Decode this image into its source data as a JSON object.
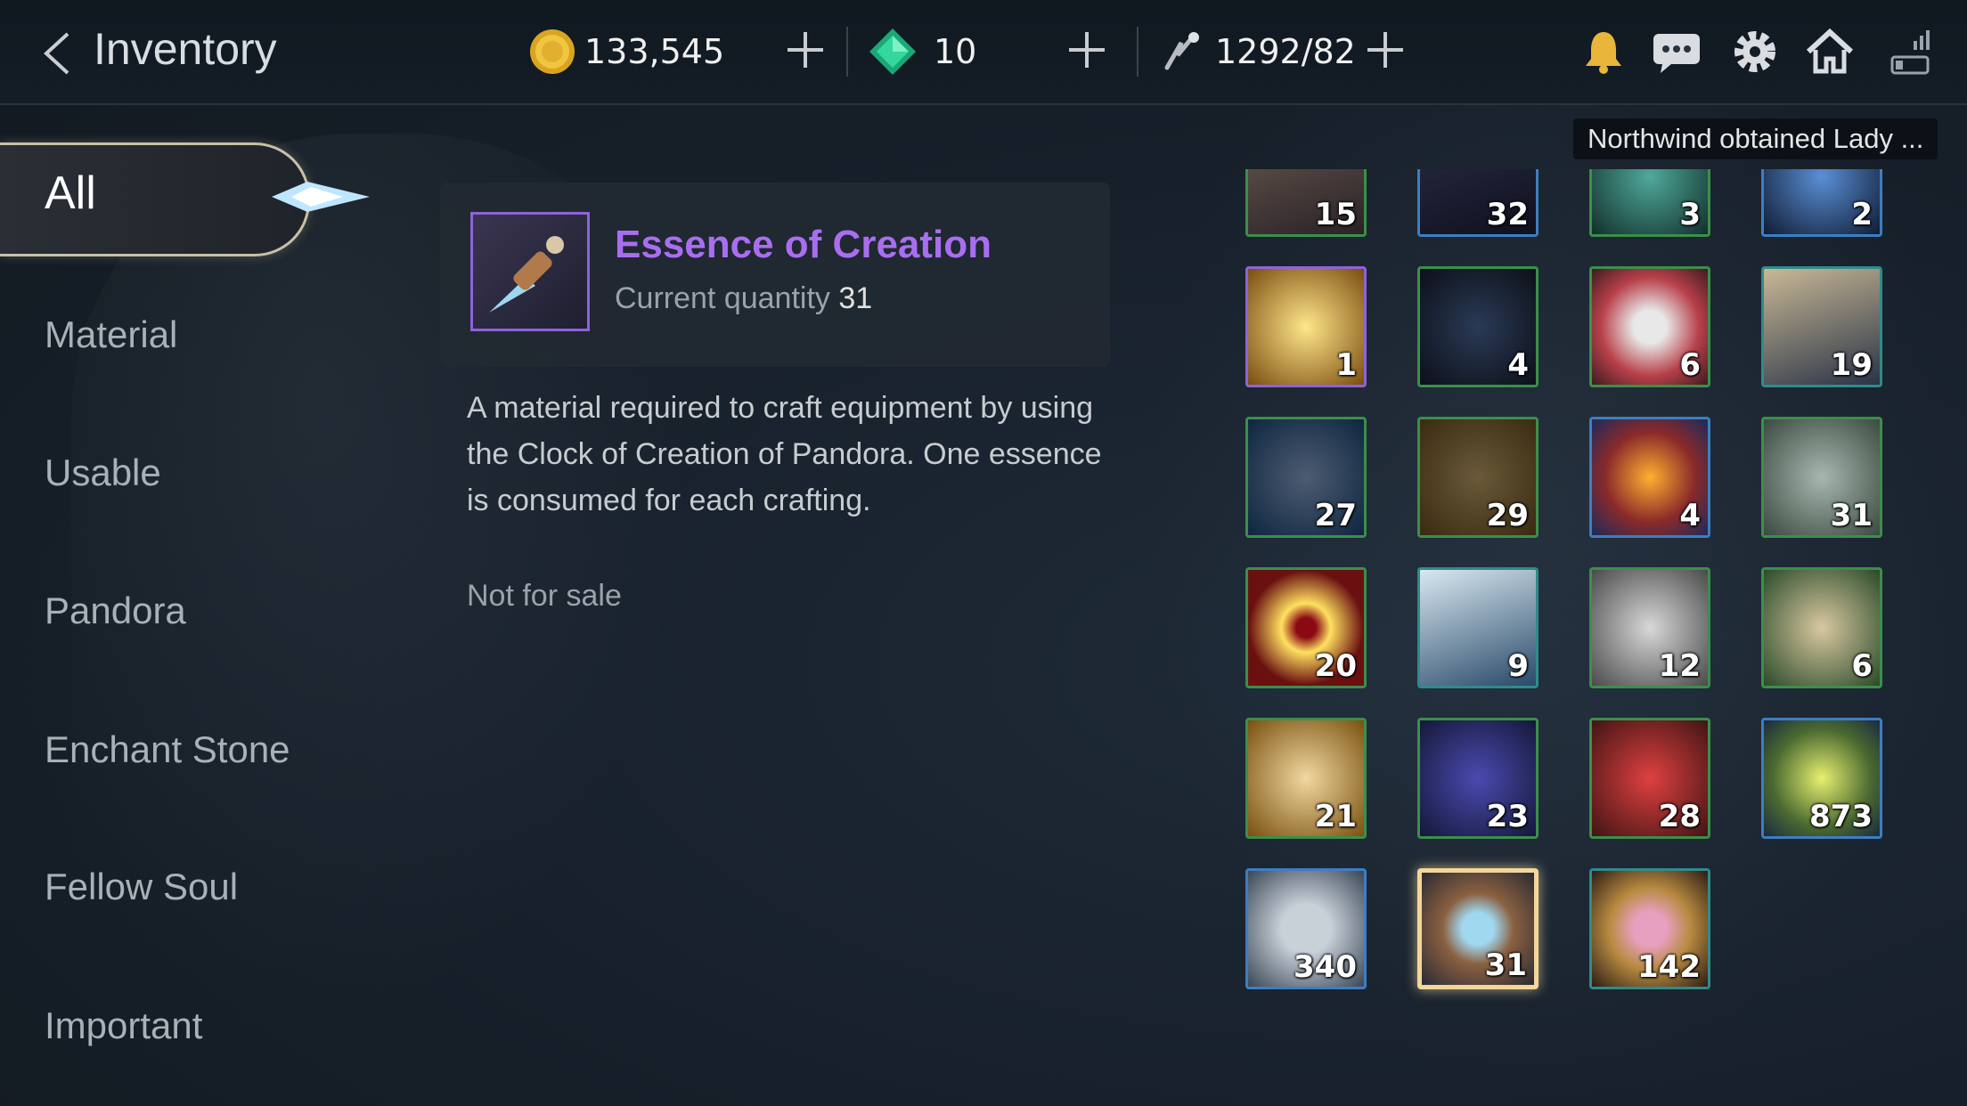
{
  "header": {
    "title": "Inventory",
    "gold": "133,545",
    "gems": "10",
    "stamina": "1292/82"
  },
  "notification": "Northwind obtained Lady ...",
  "sidebar": {
    "items": [
      {
        "label": "All",
        "active": true
      },
      {
        "label": "Material"
      },
      {
        "label": "Usable"
      },
      {
        "label": "Pandora"
      },
      {
        "label": "Enchant Stone"
      },
      {
        "label": "Fellow Soul"
      },
      {
        "label": "Important"
      }
    ]
  },
  "detail": {
    "name": "Essence of Creation",
    "qty_label": "Current quantity",
    "qty": "31",
    "description": "A material required to craft equipment by using the Clock of Creation of Pandora. One essence is consumed for each crafting.",
    "sale": "Not for sale"
  },
  "colors": {
    "accent_purple": "#a96ef0",
    "selected_border": "#f2d69a",
    "green_border": "#3b8f4a",
    "blue_border": "#3d7ec0"
  },
  "grid": [
    {
      "icon": "hero-portrait-icon",
      "qty": "15",
      "rarity": "green"
    },
    {
      "icon": "dark-crest-icon",
      "qty": "32",
      "rarity": "blue"
    },
    {
      "icon": "teal-emblem-icon",
      "qty": "3",
      "rarity": "green"
    },
    {
      "icon": "blue-emblem-icon",
      "qty": "2",
      "rarity": "blue"
    },
    {
      "icon": "star-crystal-icon",
      "qty": "1",
      "rarity": "purple"
    },
    {
      "icon": "dark-horns-icon",
      "qty": "4",
      "rarity": "green"
    },
    {
      "icon": "red-ore-icon",
      "qty": "6",
      "rarity": "green"
    },
    {
      "icon": "elf-portrait-icon",
      "qty": "19",
      "rarity": "teal"
    },
    {
      "icon": "blue-ore-icon",
      "qty": "27",
      "rarity": "green"
    },
    {
      "icon": "dark-ore-icon",
      "qty": "29",
      "rarity": "green"
    },
    {
      "icon": "magma-stone-icon",
      "qty": "4",
      "rarity": "blue"
    },
    {
      "icon": "rock-shard-icon",
      "qty": "31",
      "rarity": "green"
    },
    {
      "icon": "red-eye-icon",
      "qty": "20",
      "rarity": "green"
    },
    {
      "icon": "ice-shards-icon",
      "qty": "9",
      "rarity": "teal"
    },
    {
      "icon": "fur-pelt-icon",
      "qty": "12",
      "rarity": "green"
    },
    {
      "icon": "horn-icon",
      "qty": "6",
      "rarity": "green"
    },
    {
      "icon": "gold-crystal-icon",
      "qty": "21",
      "rarity": "green"
    },
    {
      "icon": "sapphire-icon",
      "qty": "23",
      "rarity": "green"
    },
    {
      "icon": "ruby-icon",
      "qty": "28",
      "rarity": "green"
    },
    {
      "icon": "gold-pile-icon",
      "qty": "873",
      "rarity": "blue"
    },
    {
      "icon": "infinity-icon",
      "qty": "340",
      "rarity": "blue"
    },
    {
      "icon": "essence-dagger-icon",
      "qty": "31",
      "rarity": "selected"
    },
    {
      "icon": "hourglass-icon",
      "qty": "142",
      "rarity": "teal"
    }
  ]
}
